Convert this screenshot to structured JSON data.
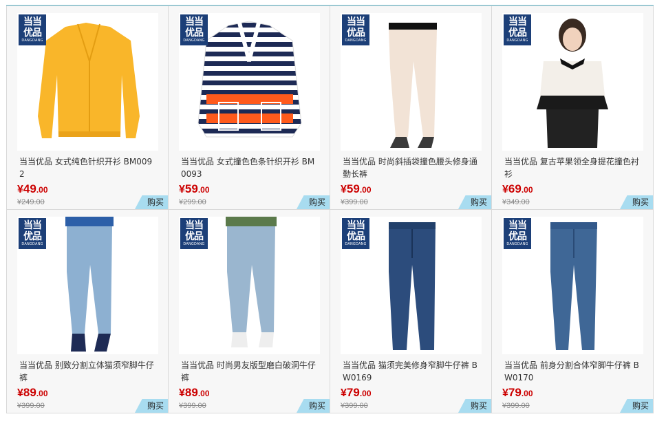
{
  "logo": {
    "line1": "当当",
    "line2": "优品",
    "line3": "DANGDANG"
  },
  "buy_label": "购买",
  "products": [
    {
      "title": "当当优品 女式纯色针织开衫 BM0092",
      "currency": "¥",
      "price_int": "49",
      "price_dec": ".00",
      "original": "¥249.00",
      "image": "yellow-cardigan"
    },
    {
      "title": "当当优品 女式撞色色条针织开衫 BM0093",
      "currency": "¥",
      "price_int": "59",
      "price_dec": ".00",
      "original": "¥299.00",
      "image": "striped-cardigan"
    },
    {
      "title": "当当优品 时尚斜插袋撞色腰头修身通勤长裤",
      "currency": "¥",
      "price_int": "59",
      "price_dec": ".00",
      "original": "¥399.00",
      "image": "cream-trousers"
    },
    {
      "title": "当当优品 复古苹果领全身提花撞色衬衫",
      "currency": "¥",
      "price_int": "69",
      "price_dec": ".00",
      "original": "¥349.00",
      "image": "white-blouse"
    },
    {
      "title": "当当优品 别致分割立体猫须窄脚牛仔裤",
      "currency": "¥",
      "price_int": "89",
      "price_dec": ".00",
      "original": "¥399.00",
      "image": "light-jeans"
    },
    {
      "title": "当当优品 时尚男友版型磨白破洞牛仔裤",
      "currency": "¥",
      "price_int": "89",
      "price_dec": ".00",
      "original": "¥399.00",
      "image": "boyfriend-jeans"
    },
    {
      "title": "当当优品 猫须完美修身窄脚牛仔裤 BW0169",
      "currency": "¥",
      "price_int": "79",
      "price_dec": ".00",
      "original": "¥399.00",
      "image": "dark-jeans"
    },
    {
      "title": "当当优品 前身分割合体窄脚牛仔裤 BW0170",
      "currency": "¥",
      "price_int": "79",
      "price_dec": ".00",
      "original": "¥399.00",
      "image": "blue-jeans"
    }
  ],
  "colors": {
    "price": "#cc0000",
    "buy_bg": "#a8dcf0",
    "logo_bg": "#1c3f78",
    "accent_line": "#5fb7cc"
  }
}
